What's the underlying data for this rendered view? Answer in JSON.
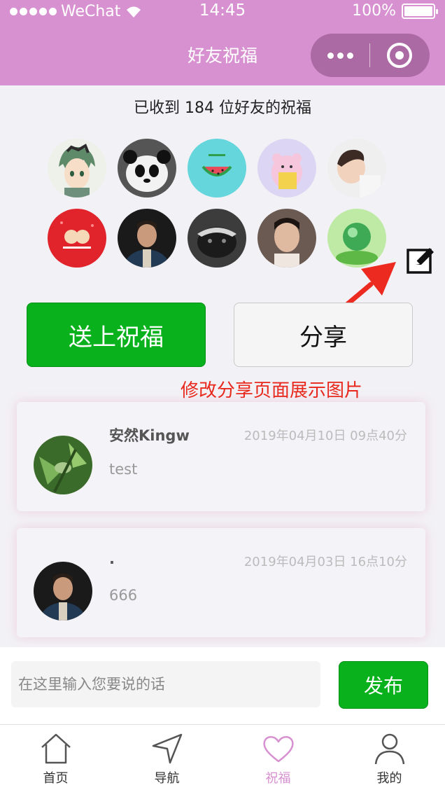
{
  "status_bar": {
    "carrier": "WeChat",
    "time": "14:45",
    "battery": "100%"
  },
  "nav": {
    "title": "好友祝福"
  },
  "received": "已收到 184 位好友的祝福",
  "avatars": [
    "anime-boy",
    "panda",
    "watermelon",
    "pink-pig",
    "child",
    "cartoon-dogs",
    "man-portrait",
    "honey-badger",
    "young-man",
    "green-globe"
  ],
  "buttons": {
    "send_blessing": "送上祝福",
    "share": "分享"
  },
  "annotation": "修改分享页面展示图片",
  "messages": [
    {
      "name": "安然Kingw",
      "date": "2019年04月10日 09点40分",
      "text": "test"
    },
    {
      "name": ".",
      "date": "2019年04月03日 16点10分",
      "text": "666"
    }
  ],
  "composer": {
    "placeholder": "在这里输入您要说的话",
    "post": "发布"
  },
  "tabs": [
    {
      "label": "首页",
      "icon": "home-icon"
    },
    {
      "label": "导航",
      "icon": "navigation-icon"
    },
    {
      "label": "祝福",
      "icon": "heart-icon"
    },
    {
      "label": "我的",
      "icon": "user-icon"
    }
  ],
  "colors": {
    "nav": "#d891d0",
    "primary": "#09b21c",
    "annotation": "#e8281c"
  }
}
